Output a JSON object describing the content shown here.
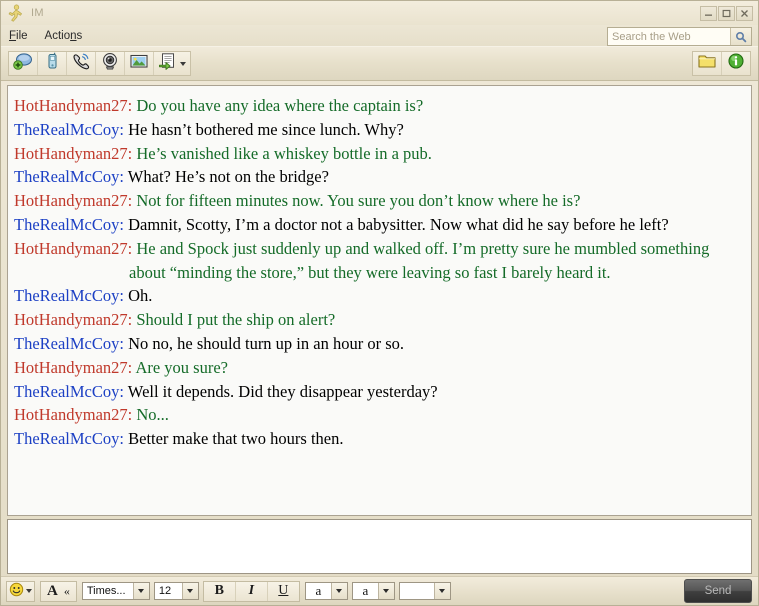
{
  "window": {
    "title": "IM",
    "app_icon": "aim-running-man-icon",
    "controls": {
      "minimize": "minimize-icon",
      "maximize": "maximize-icon",
      "close": "close-icon"
    }
  },
  "menubar": {
    "items": [
      {
        "label": "File",
        "mnemonic": "F"
      },
      {
        "label": "Actions",
        "mnemonic": "n"
      }
    ]
  },
  "search": {
    "placeholder": "Search the Web",
    "value": "",
    "button_icon": "search-icon"
  },
  "toolbar": {
    "left_buttons": [
      {
        "name": "new-chat-invite-button",
        "icon": "chat-bubble-plus-icon",
        "title": "Invite to chat"
      },
      {
        "name": "mobile-message-button",
        "icon": "mobile-phone-icon",
        "title": "Send to mobile"
      },
      {
        "name": "talk-button",
        "icon": "phone-call-icon",
        "title": "Talk"
      },
      {
        "name": "video-button",
        "icon": "webcam-icon",
        "title": "Video"
      },
      {
        "name": "send-picture-button",
        "icon": "picture-icon",
        "title": "Send picture"
      },
      {
        "name": "send-file-button",
        "icon": "send-file-icon",
        "title": "Send file",
        "has_dropdown": true
      }
    ],
    "right_buttons": [
      {
        "name": "saved-im-folder-button",
        "icon": "folder-icon",
        "title": "Saved IMs"
      },
      {
        "name": "buddy-info-button",
        "icon": "info-circle-icon",
        "title": "Buddy info"
      }
    ]
  },
  "colors": {
    "nick_red": "#c0392b",
    "nick_blue": "#1b3fc4",
    "body_green": "#146b28",
    "body_black": "#000000",
    "window_tan": "#e9e2ce",
    "chat_background": "#fafaf8",
    "send_button_bg": "#3f3f3f"
  },
  "chat": {
    "messages": [
      {
        "nick": "HotHandyman27:",
        "nick_color": "red",
        "body_color": "green",
        "text": "Do you have any idea where the captain is?"
      },
      {
        "nick": "TheRealMcCoy:",
        "nick_color": "blue",
        "body_color": "black",
        "text": "He hasn’t bothered me since lunch. Why?"
      },
      {
        "nick": "HotHandyman27:",
        "nick_color": "red",
        "body_color": "green",
        "text": "He’s vanished like a whiskey bottle in a pub."
      },
      {
        "nick": "TheRealMcCoy:",
        "nick_color": "blue",
        "body_color": "black",
        "text": "What? He’s not on the bridge?"
      },
      {
        "nick": "HotHandyman27:",
        "nick_color": "red",
        "body_color": "green",
        "text": "Not for fifteen minutes now. You sure you don’t know where he is?"
      },
      {
        "nick": "TheRealMcCoy:",
        "nick_color": "blue",
        "body_color": "black",
        "text": "Damnit, Scotty, I’m a doctor not a babysitter. Now what did he say before he left?"
      },
      {
        "nick": "HotHandyman27:",
        "nick_color": "red",
        "body_color": "green",
        "text": "He and Spock just suddenly up and walked off. I’m pretty sure he mumbled something about “minding the store,” but they were leaving so fast I barely heard it."
      },
      {
        "nick": "TheRealMcCoy:",
        "nick_color": "blue",
        "body_color": "black",
        "text": "Oh."
      },
      {
        "nick": "HotHandyman27:",
        "nick_color": "red",
        "body_color": "green",
        "text": "Should I put the ship on alert?"
      },
      {
        "nick": "TheRealMcCoy:",
        "nick_color": "blue",
        "body_color": "black",
        "text": "No no, he should turn up in an hour or so."
      },
      {
        "nick": "HotHandyman27:",
        "nick_color": "red",
        "body_color": "green",
        "text": "Are you sure?"
      },
      {
        "nick": "TheRealMcCoy:",
        "nick_color": "blue",
        "body_color": "black",
        "text": "Well it depends. Did they disappear yesterday?"
      },
      {
        "nick": "HotHandyman27:",
        "nick_color": "red",
        "body_color": "green",
        "text": "No..."
      },
      {
        "nick": "TheRealMcCoy:",
        "nick_color": "blue",
        "body_color": "black",
        "text": "Better make that two hours then."
      }
    ]
  },
  "compose": {
    "value": "",
    "placeholder": ""
  },
  "formatbar": {
    "smiley_icon": "smiley-face-icon",
    "font_style_icon": "font-letter-a-icon",
    "quote_icon": "quote-marks-icon",
    "font_family": "Times...",
    "font_size": "12",
    "bold_label": "B",
    "italic_label": "I",
    "underline_label": "U",
    "text_color_label": "a",
    "background_color_label": "a",
    "highlight_color_label": "",
    "send_label": "Send"
  }
}
